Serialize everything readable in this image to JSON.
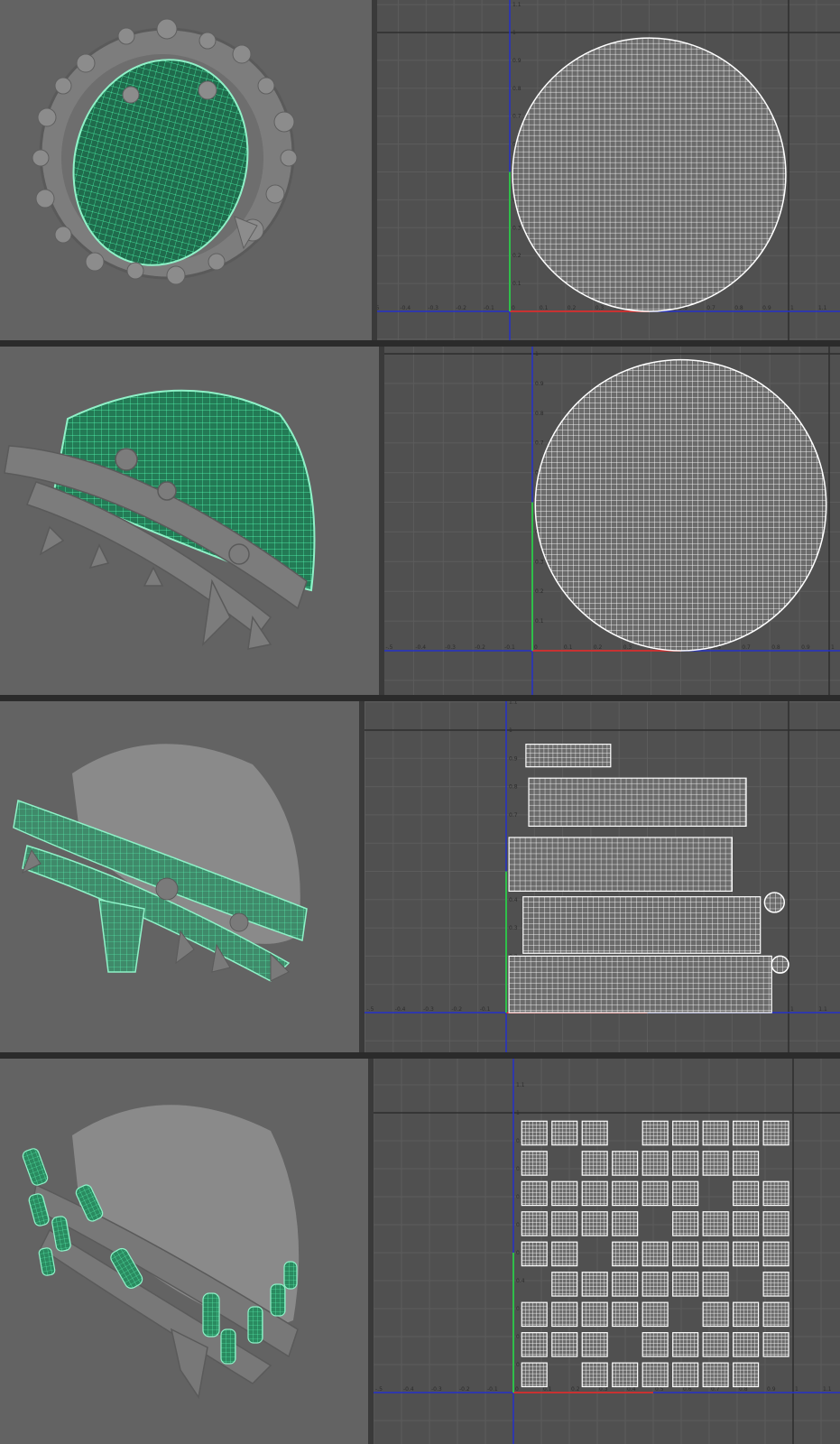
{
  "app": {
    "view_3d": "perspective-viewport",
    "view_uv": "uv-editor"
  },
  "uv_editor": {
    "axis_x_ticks": [
      "-.5",
      "-0.4",
      "-0.3",
      "-0.2",
      "-0.1",
      "0",
      "0.1",
      "0.2",
      "0.3",
      "0.4",
      "0.5",
      "0.6",
      "0.7",
      "0.8",
      "0.9",
      "1",
      "1.1"
    ],
    "axis_y_ticks": [
      "0",
      "0.1",
      "0.2",
      "0.3",
      "0.4",
      "0.5",
      "0.6",
      "0.7",
      "0.8",
      "0.9",
      "1",
      "1.1"
    ],
    "axis_x_range": [
      -0.5,
      1.1
    ],
    "axis_y_range": [
      -0.1,
      1.1
    ],
    "grid": true
  },
  "colors": {
    "viewport_bg": "#636363",
    "uv_bg": "#505050",
    "grid_line": "#5c5c5c",
    "mesh_gray": "#8a8a8a",
    "selection_wire": "#3dffa6",
    "uv_wire": "#ffffff",
    "axis_u": "#c83232",
    "axis_v": "#2fbf4a",
    "axis_blue": "#2430c8"
  },
  "panels": [
    {
      "selection": "cap-dome-from-below",
      "uv_layout": "single-circle-shell"
    },
    {
      "selection": "cap-dome-side",
      "uv_layout": "single-circle-shell"
    },
    {
      "selection": "band-rolls",
      "uv_layout": "strip-shells"
    },
    {
      "selection": "spikes",
      "uv_layout": "many-small-shells"
    }
  ]
}
